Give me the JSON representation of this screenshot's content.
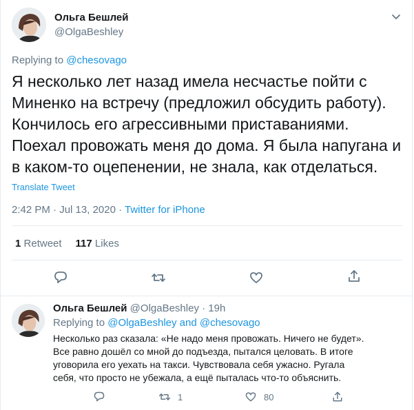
{
  "tweet": {
    "author_name": "Ольга Бешлей",
    "author_handle": "@OlgaBeshley",
    "replying_prefix": "Replying to ",
    "replying_to": "@chesovago",
    "text": "Я несколько лет назад имела несчастье пойти с\nМиненко на встречу (предложил обсудить работу).\nКончилось его агрессивными приставаниями.\nПоехал провожать меня до дома. Я была напугана и\nв каком-то оцепенении, не знала, как отделаться.",
    "translate_label": "Translate Tweet",
    "time": "2:42 PM",
    "date": "Jul 13, 2020",
    "source": "Twitter for iPhone",
    "retweets_count": "1",
    "retweets_label": "Retweet",
    "likes_count": "117",
    "likes_label": "Likes"
  },
  "reply": {
    "author_name": "Ольга Бешлей",
    "author_handle": "@OlgaBeshley",
    "age": "19h",
    "replying_prefix": "Replying to ",
    "replying_to": "@OlgaBeshley and @chesovago",
    "text": "Несколько раз сказала: «Не надо меня провожать. Ничего не будет».\nВсе равно дошёл со мной до подъезда, пытался целовать. В итоге\nуговорила его уехать на такси. Чувствовала себя ужасно. Ругала\nсебя, что просто не убежала, а ещё пыталась что-то объяснить.",
    "retweet_count": "1",
    "like_count": "80"
  },
  "icons": {
    "reply": "reply-bubble-icon",
    "retweet": "retweet-icon",
    "like": "heart-icon",
    "share": "share-icon",
    "more": "chevron-down-icon"
  },
  "colors": {
    "link": "#1b95e0",
    "text": "#14171a",
    "secondary": "#657786",
    "border": "#e6ecf0"
  }
}
